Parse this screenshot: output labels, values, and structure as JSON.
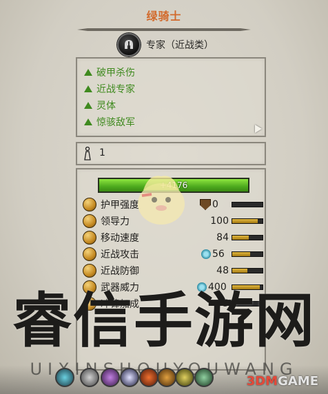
{
  "unit": {
    "name": "绿骑士",
    "class": "专家（近战类）"
  },
  "traits": [
    {
      "label": "破甲杀伤"
    },
    {
      "label": "近战专家"
    },
    {
      "label": "灵体"
    },
    {
      "label": "惊骇敌军"
    }
  ],
  "unit_count": "1",
  "health": {
    "text": "+4176",
    "fraction": 1.0
  },
  "stats": [
    {
      "name": "护甲强度",
      "value": "0",
      "fill": 0.0,
      "icon": "armor-icon",
      "modifier": "shield-icon"
    },
    {
      "name": "领导力",
      "value": "100",
      "fill": 0.85,
      "icon": "leadership-icon"
    },
    {
      "name": "移动速度",
      "value": "84",
      "fill": 0.55,
      "icon": "speed-icon"
    },
    {
      "name": "近战攻击",
      "value": "56",
      "fill": 0.6,
      "icon": "melee-attack-icon",
      "modifier": "ethereal-icon"
    },
    {
      "name": "近战防御",
      "value": "48",
      "fill": 0.5,
      "icon": "melee-defence-icon"
    },
    {
      "name": "武器威力",
      "value": "400",
      "fill": 0.9,
      "icon": "weapon-strength-icon",
      "modifier": "gear-icon"
    },
    {
      "name": "冲锋加成",
      "value": "5",
      "fill": 0.1,
      "icon": "charge-icon"
    }
  ],
  "watermark": {
    "text": "睿信手游网",
    "pinyin": "UIXINSHOUYOUWANG"
  },
  "brand": {
    "prefix": "3DM",
    "suffix": "GAME"
  },
  "colors": {
    "title": "#d26a2c",
    "trait_green": "#3f8a1f",
    "hp_green": "#6ccf2c",
    "stat_bar": "#c99a2a"
  }
}
